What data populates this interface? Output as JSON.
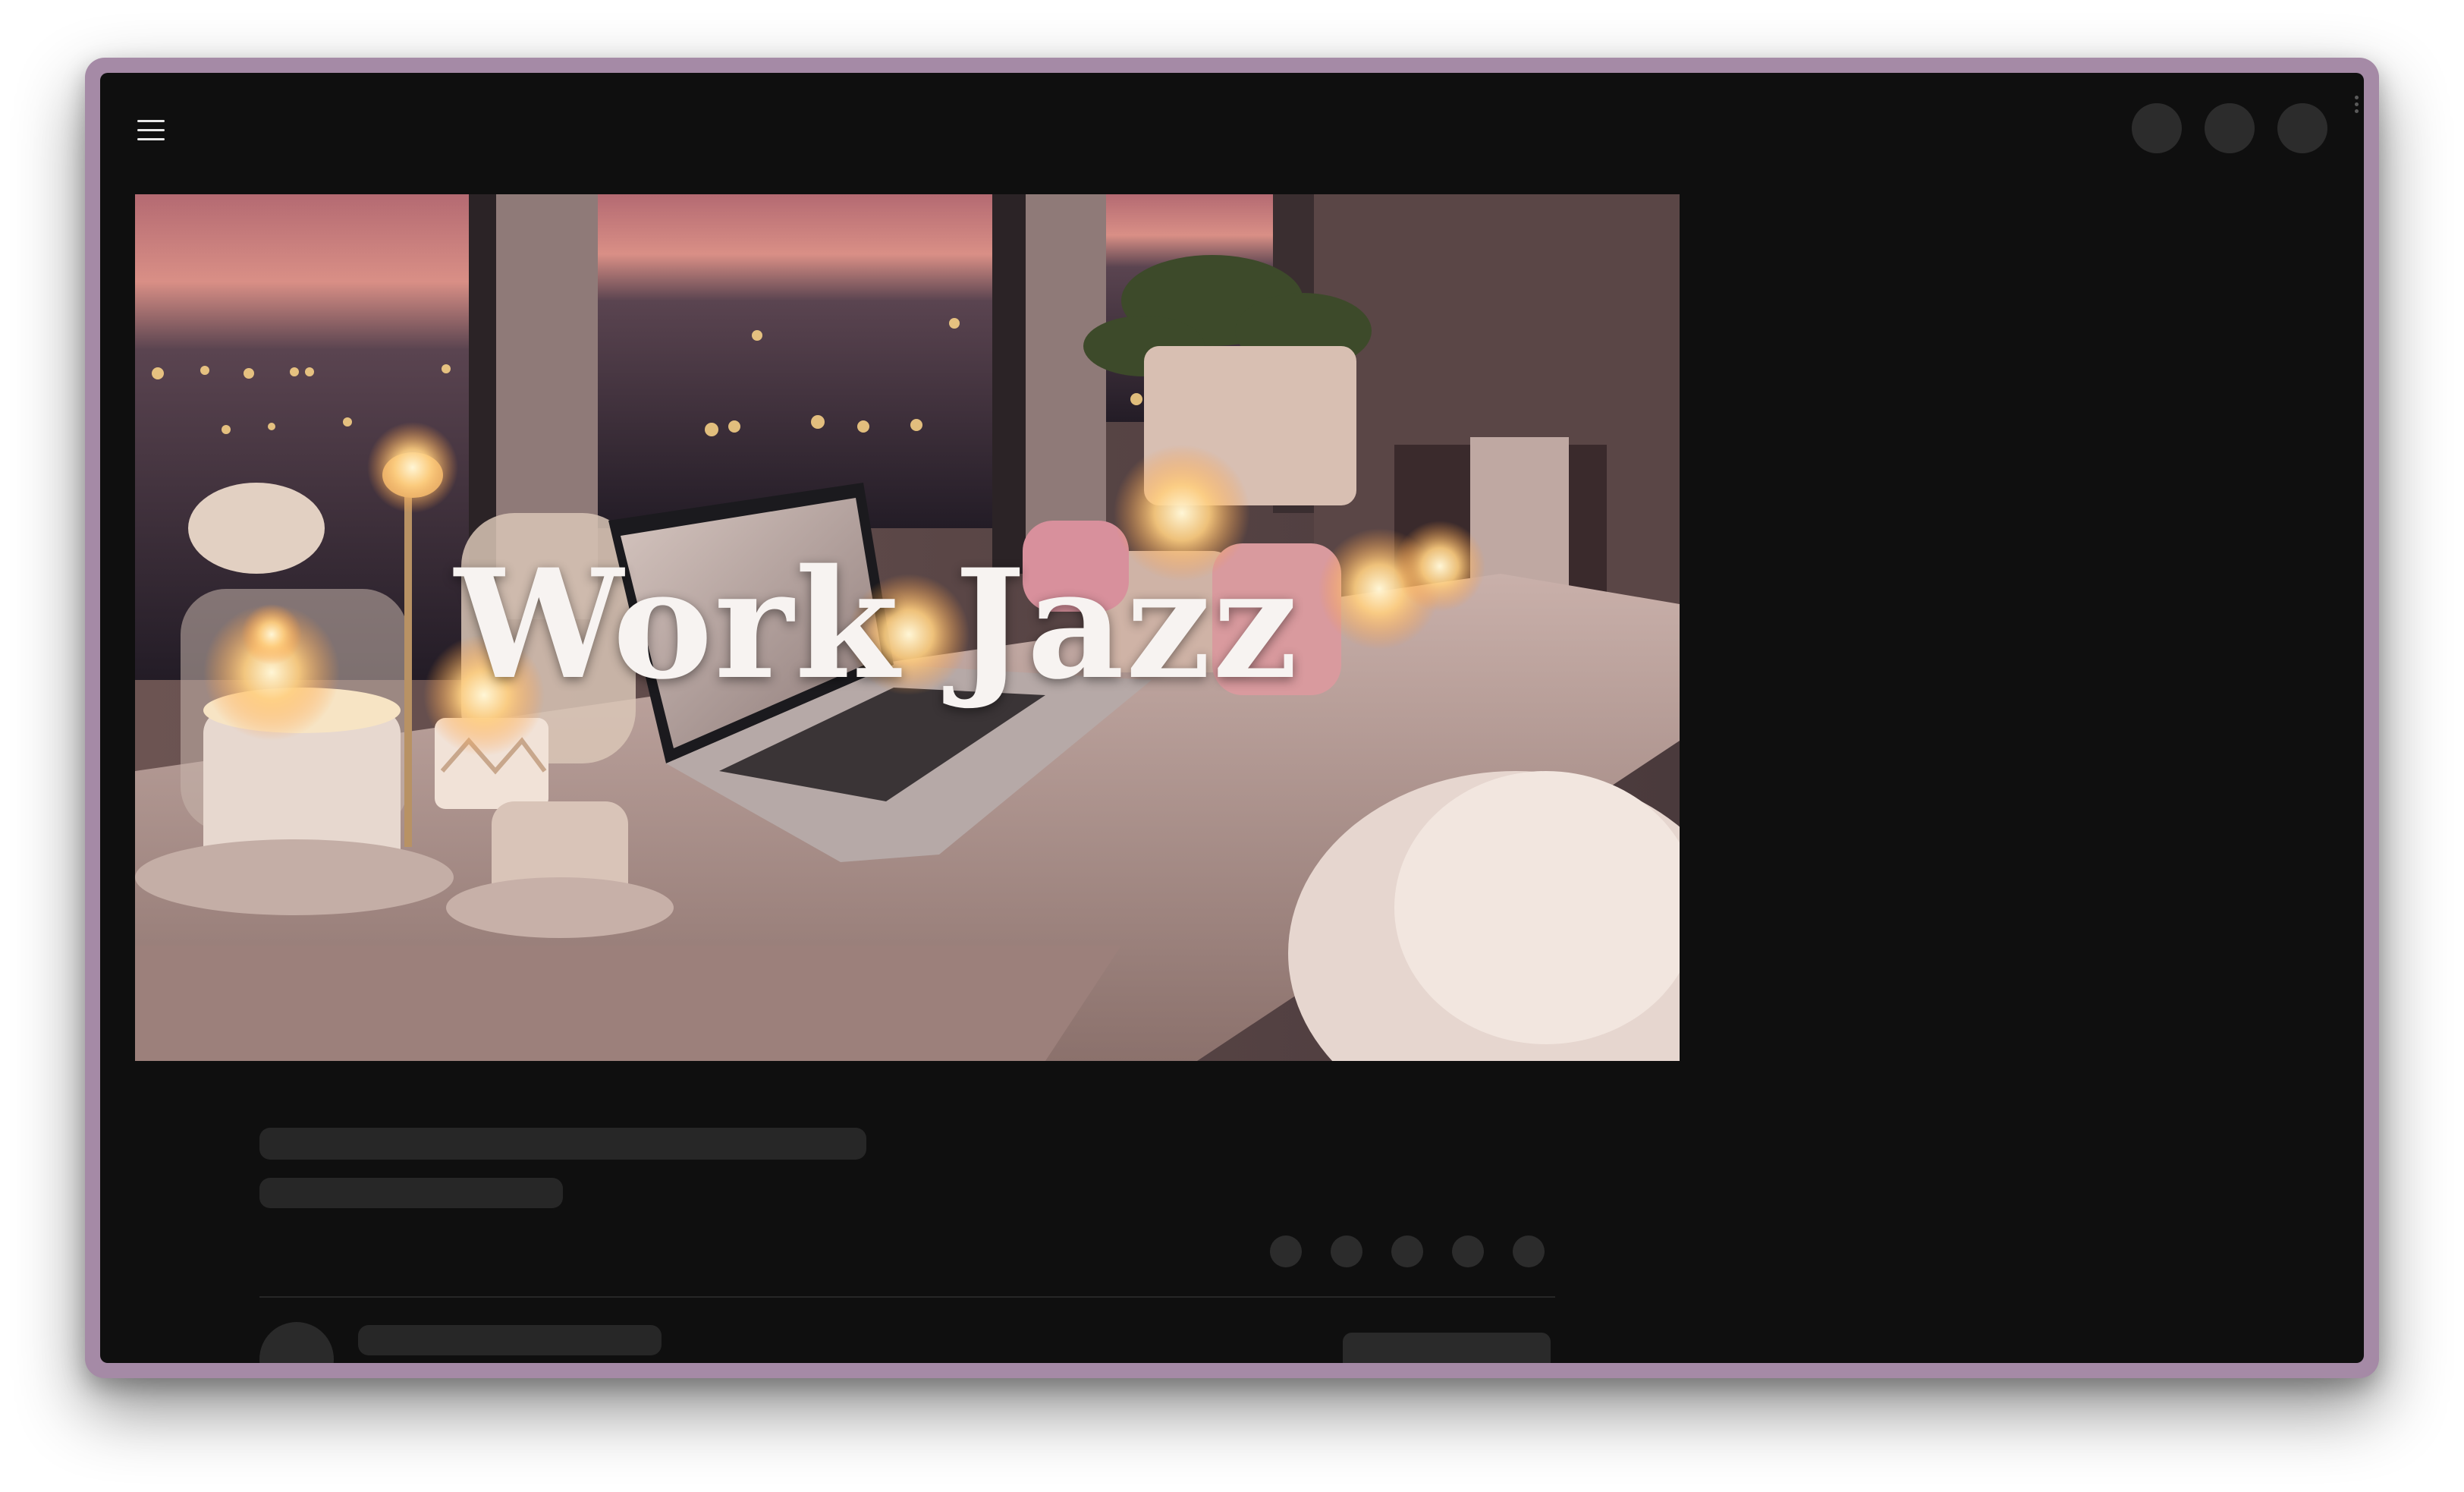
{
  "video": {
    "thumbnail_title": "Work Jazz"
  },
  "icons": {
    "menu": "hamburger-menu-icon"
  },
  "colors": {
    "window_border": "#a58aa6",
    "app_background": "#0f0f0f",
    "skeleton": "#272727"
  }
}
